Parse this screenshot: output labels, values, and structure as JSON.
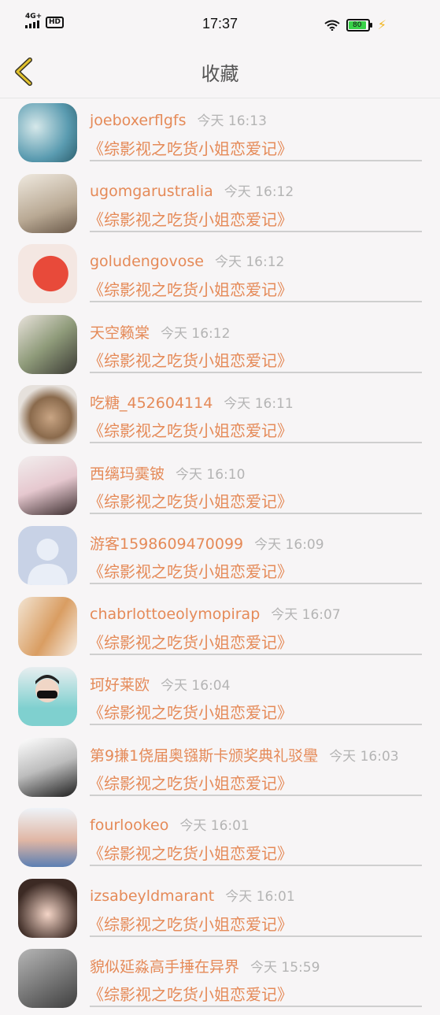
{
  "status_bar": {
    "network": "4G+",
    "hd": "HD",
    "time": "17:37",
    "battery": "80"
  },
  "nav": {
    "back_icon": "chevron-left-icon",
    "title": "收藏"
  },
  "colors": {
    "accent": "#e58a58",
    "muted": "#b4b4b4",
    "back_arrow": "#e2c22e"
  },
  "items": [
    {
      "name": "joeboxerflgfs",
      "time": "今天 16:13",
      "book": "《综影视之吃货小姐恋爱记》"
    },
    {
      "name": "ugomgarustralia",
      "time": "今天 16:12",
      "book": "《综影视之吃货小姐恋爱记》"
    },
    {
      "name": "goludengovose",
      "time": "今天 16:12",
      "book": "《综影视之吃货小姐恋爱记》"
    },
    {
      "name": "天空籁棠",
      "time": "今天 16:12",
      "book": "《综影视之吃货小姐恋爱记》"
    },
    {
      "name": "吃糖_452604114",
      "time": "今天 16:11",
      "book": "《综影视之吃货小姐恋爱记》"
    },
    {
      "name": "西缡玛霙铍",
      "time": "今天 16:10",
      "book": "《综影视之吃货小姐恋爱记》"
    },
    {
      "name": "游客1598609470099",
      "time": "今天 16:09",
      "book": "《综影视之吃货小姐恋爱记》"
    },
    {
      "name": "chabrlottoeolymopirap",
      "time": "今天 16:07",
      "book": "《综影视之吃货小姐恋爱记》"
    },
    {
      "name": "珂好莱欧",
      "time": "今天 16:04",
      "book": "《综影视之吃货小姐恋爱记》"
    },
    {
      "name": "第9搛1侥届奥镪斯卡颁奖典礼驳璺",
      "time": "今天 16:03",
      "book": "《综影视之吃货小姐恋爱记》"
    },
    {
      "name": "fourlookeo",
      "time": "今天 16:01",
      "book": "《综影视之吃货小姐恋爱记》"
    },
    {
      "name": "izsabeyldmarant",
      "time": "今天 16:01",
      "book": "《综影视之吃货小姐恋爱记》"
    },
    {
      "name": "貌似延淼高手捶在异界",
      "time": "今天 15:59",
      "book": "《综影视之吃货小姐恋爱记》"
    }
  ]
}
